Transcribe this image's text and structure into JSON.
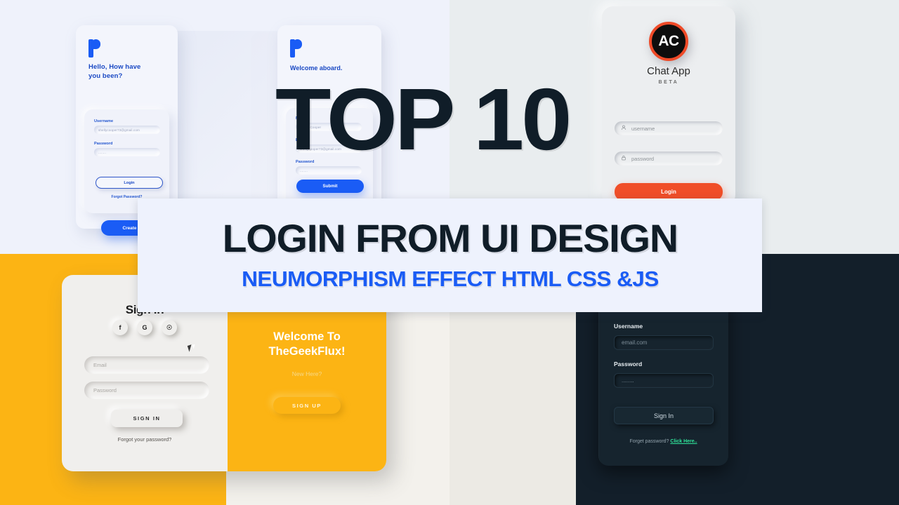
{
  "colors": {
    "bg_top_left": "#eff2fb",
    "bg_top_right": "#e9edef",
    "bg_bottom_left": "#fcb414",
    "bg_bottom_mid": "#f3f1ec",
    "bg_bottom_right": "#131f2a",
    "accent_blue": "#1a5cf5",
    "accent_orange": "#f04e28",
    "accent_yellow": "#fcb414",
    "accent_green": "#2fe39a",
    "title_dark": "#101d28"
  },
  "overlay": {
    "top_number": "TOP 10",
    "title_main": "LOGIN FROM UI DESIGN",
    "title_sub": "NEUMORPHISM  EFFECT HTML CSS &JS"
  },
  "card1": {
    "logo": "p-logo-icon",
    "greeting": "Hello, How have\nyou been?",
    "username_label": "Username",
    "username_value": "shellycooper73@gmail.com",
    "password_label": "Password",
    "password_value": "........",
    "login_label": "Login",
    "forgot_label": "Forgot Password?",
    "create_account_label": "Create Account"
  },
  "card2": {
    "logo": "p-logo-icon",
    "greeting": "Welcome aboard.",
    "name_label": "Name",
    "name_value": "Shelly Cooper",
    "email_label": "Email",
    "email_value": "shellycooper73@gmail.com",
    "password_label": "Password",
    "password_value": "........",
    "submit_label": "Submit"
  },
  "card3": {
    "logo_text": "AC",
    "app_title": "Chat App",
    "badge": "BETA",
    "username_placeholder": "username",
    "password_placeholder": "password",
    "login_label": "Login",
    "user_icon": "user-icon",
    "lock_icon": "lock-icon"
  },
  "card4": {
    "title": "Sign in",
    "social": [
      {
        "name": "facebook-icon",
        "glyph": "f"
      },
      {
        "name": "google-icon",
        "glyph": "G"
      },
      {
        "name": "github-icon",
        "glyph": "☉"
      }
    ],
    "email_placeholder": "Email",
    "password_placeholder": "Password",
    "signin_label": "SIGN IN",
    "forgot_label": "Forgot your password?",
    "panel_title": "Welcome To\nTheGeekFlux!",
    "panel_sub": "New Here?",
    "signup_label": "SIGN UP"
  },
  "card5": {
    "username_label": "Username",
    "username_value": "email.com",
    "password_label": "Password",
    "password_value": "........",
    "signin_label": "Sign In",
    "forgot_prefix": "Forget password? ",
    "forgot_link": "Click Here.."
  }
}
